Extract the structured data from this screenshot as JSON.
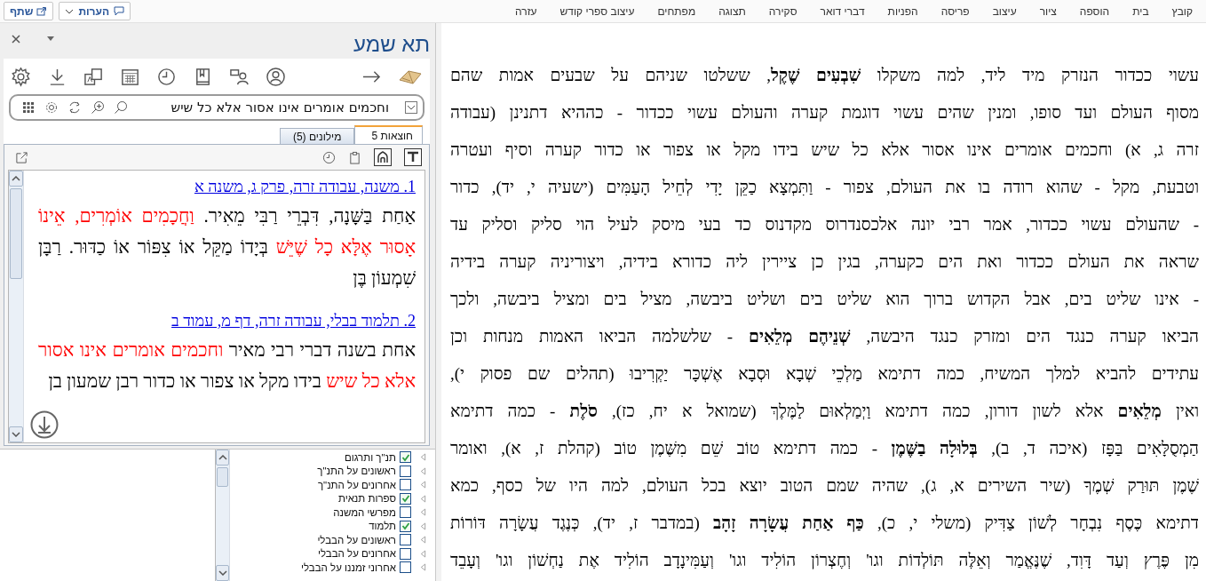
{
  "menu_bar": {
    "items": [
      "קובץ",
      "בית",
      "הוספה",
      "ציור",
      "עיצוב",
      "פריסה",
      "הפניות",
      "דברי דואר",
      "סקירה",
      "תצוגה",
      "מפתחים",
      "עיצוב ספרי קודש",
      "עזרה"
    ],
    "comments_button": "הערות",
    "share_button": "שתף"
  },
  "side_panel": {
    "title": "תא שמע",
    "search": {
      "value": "וחכמים אומרים אינו אסור אלא כל שיש"
    },
    "tabs": [
      {
        "label": "חוצאות 5",
        "selected": true
      },
      {
        "label": "מילונים (5)",
        "selected": false
      }
    ],
    "results": [
      {
        "heading": "1. משנה, עבודה זרה, פרק ג, משנה א",
        "segments": [
          {
            "text": "אַחַת בַּשָּׁנָה, דִּבְרֵי רַבִּי מֵאִיר. ",
            "highlight": false
          },
          {
            "text": "וַחֲכָמִים אוֹמְרִים, אֵינוֹ אָסוּר אֶלָּא כָל שֶׁיֵּשׁ",
            "highlight": true
          },
          {
            "text": " בְּיָדוֹ מַקֵּל אוֹ צִפּוֹר אוֹ כַדּוּר. רַבָּן שִׁמְעוֹן בֶּן",
            "highlight": false
          }
        ]
      },
      {
        "heading": "2. תלמוד בבלי, עבודה זרה, דף מ, עמוד ב",
        "segments": [
          {
            "text": "אחת בשנה דברי רבי מאיר ",
            "highlight": false
          },
          {
            "text": "וחכמים אומרים אינו אסור אלא כל שיש",
            "highlight": true
          },
          {
            "text": " בידו מקל או צפור או כדור רבן שמעון בן",
            "highlight": false
          }
        ]
      }
    ],
    "filter_tree": [
      {
        "label": "תנ\"ך ותרגום",
        "checked": true
      },
      {
        "label": "ראשונים על התנ\"ך",
        "checked": false
      },
      {
        "label": "אחרונים על התנ\"ך",
        "checked": false
      },
      {
        "label": "ספרות תנאית",
        "checked": true
      },
      {
        "label": "מפרשי המשנה",
        "checked": false
      },
      {
        "label": "תלמוד",
        "checked": true
      },
      {
        "label": "ראשונים על הבבלי",
        "checked": false
      },
      {
        "label": "אחרונים על הבבלי",
        "checked": false
      },
      {
        "label": "אחרוני זמננו על הבבלי",
        "checked": false
      }
    ]
  },
  "document": {
    "lines": [
      "עשוי ככדור הנזרק מיד ליד, למה משקלו **שִׁבְעִים שֶׁקֶל**, ששלטו שניהם על שבעים אמות שהם",
      "מסוף העולם ועד סופו, ומנין שהים עשוי דוגמת קערה והעולם עשוי ככדור - כההיא דתנינן (עבודה",
      "זרה ג, א) וחכמים אומרים אינו אסור אלא כל שיש בידו מקל או צפור או כדור קערה וסיף ועטרה",
      "וטבעת, מקל - שהוא רודה בו את העולם, צפור - וַתִּמְצָא כַקֵּן יָדִי לְחֵיל הָעַמִּים (ישעיה י, יד), כדור",
      "- שהעולם עשוי ככדור, אמר רבי יונה אלכסנדרוס מקדנוס כד בעי מיסק לעיל הוי סליק וסליק עד",
      "שראה את העולם ככדור ואת הים כקערה, בגין כן ציירין ליה כדורא בידיה, ויצוריניה קערה בידיה",
      "- אינו שליט בים, אבל הקדוש ברוך הוא שליט בים ושליט ביבשה, מציל בים ומציל ביבשה, ולכך",
      "הביאו קערה כנגד הים ומזרק כנגד היבשה, **שְׁנֵיהֶם מְלֵאִים** - שלשלמה הביאו האמות מנחות וכן",
      "עתידים להביא למלך המשיח, כמה דתימא מַלְכֵי שְׁבָא וּסְבָא אֶשְׁכָּר יַקְרִיבוּ (תהלים שם פסוק י),",
      "ואין **מְלֵאִים** אלא לשון דורון, כמה דתימא וַיְמַלְאוּם לַמֶּלֶךְ (שמואל א יח, כז), **סֹלֶת** - כמה דתימא",
      "הַמְסֻלָּאִים בַּפָּז (איכה ד, ב), **בְּלוּלָה בַשֶּׁמֶן** - כמה דתימא טוֹב שֵׁם מִשֶּׁמֶן טוֹב (קהלת ז, א), ואומר",
      "שֶׁמֶן תּוּרַק שְׁמֶךָ (שיר השירים א, ג), שהיה שמם הטוב יוצא בכל העולם, למה היו של כסף, כמא",
      "דתימא כֶּסֶף נִבְחָר לְשׁוֹן צַדִּיק (משלי י, כ), **כַּף אַחַת עֲשָׂרָה זָהָב** (במדבר ז, יד), כְּנֶגֶד עֲשָׂרָה דּוֹרוֹת",
      "מִן פֶּרֶץ וְעַד דָּוִד, שֶׁנֶּאֱמַר וְאֵלֶּה תּוֹלְדוֹת וגו' וְחֶצְרוֹן הוֹלִיד וגו' וְעַמִּינָדָב הוֹלִיד אֶת נַחְשׁוֹן וגו' וְעָבֵד"
    ]
  }
}
